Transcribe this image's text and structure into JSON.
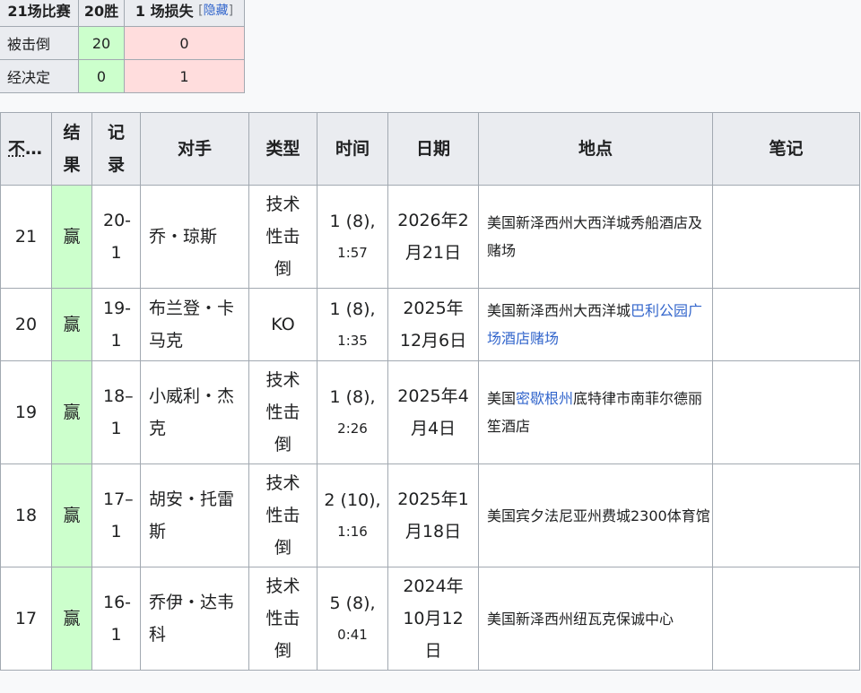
{
  "summary": {
    "total_label": "21场比赛",
    "wins_label": "20胜",
    "losses_label": "1 场损失",
    "hide_link": "隐藏",
    "rows": [
      {
        "label": "被击倒",
        "wins": "20",
        "losses": "0"
      },
      {
        "label": "经决定",
        "wins": "0",
        "losses": "1"
      }
    ]
  },
  "record": {
    "headers": {
      "no": "不。",
      "no_truncated": "不...",
      "result": "结果",
      "record": "记录",
      "opponent": "对手",
      "type": "类型",
      "time": "时间",
      "date": "日期",
      "location": "地点",
      "notes": "笔记"
    },
    "rows": [
      {
        "no": "21",
        "result": "赢",
        "record": "20-1",
        "opponent": "乔・琼斯",
        "type": "技术性击倒",
        "round": "1 (8),",
        "clock": "1:57",
        "date": "2026年2月21日",
        "loc_pre": "美国新泽西州大西洋城秀船酒店及赌场",
        "loc_link": "",
        "loc_post": "",
        "notes": ""
      },
      {
        "no": "20",
        "result": "赢",
        "record": "19-1",
        "opponent": "布兰登・卡马克",
        "type": "KO",
        "round": "1 (8),",
        "clock": "1:35",
        "date": "2025年12月6日",
        "loc_pre": "美国新泽西州大西洋城",
        "loc_link": "巴利公园广场酒店赌场",
        "loc_post": "",
        "notes": ""
      },
      {
        "no": "19",
        "result": "赢",
        "record": "18–1",
        "opponent": "小威利・杰克",
        "type": "技术性击倒",
        "round": "1 (8),",
        "clock": "2:26",
        "date": "2025年4月4日",
        "loc_pre": "美国",
        "loc_link": "密歇根州",
        "loc_post": "底特律市南菲尔德丽笙酒店",
        "notes": ""
      },
      {
        "no": "18",
        "result": "赢",
        "record": "17–1",
        "opponent": "胡安・托雷斯",
        "type": "技术性击倒",
        "round": "2 (10),",
        "clock": "1:16",
        "date": "2025年1月18日",
        "loc_pre": "美国宾夕法尼亚州费城2300体育馆",
        "loc_link": "",
        "loc_post": "",
        "notes": ""
      },
      {
        "no": "17",
        "result": "赢",
        "record": "16-1",
        "opponent": "乔伊・达韦科",
        "type": "技术性击倒",
        "round": "5 (8),",
        "clock": "0:41",
        "date": "2024年10月12日",
        "loc_pre": "美国新泽西州纽瓦克保诚中心",
        "loc_link": "",
        "loc_post": "",
        "notes": ""
      }
    ]
  }
}
